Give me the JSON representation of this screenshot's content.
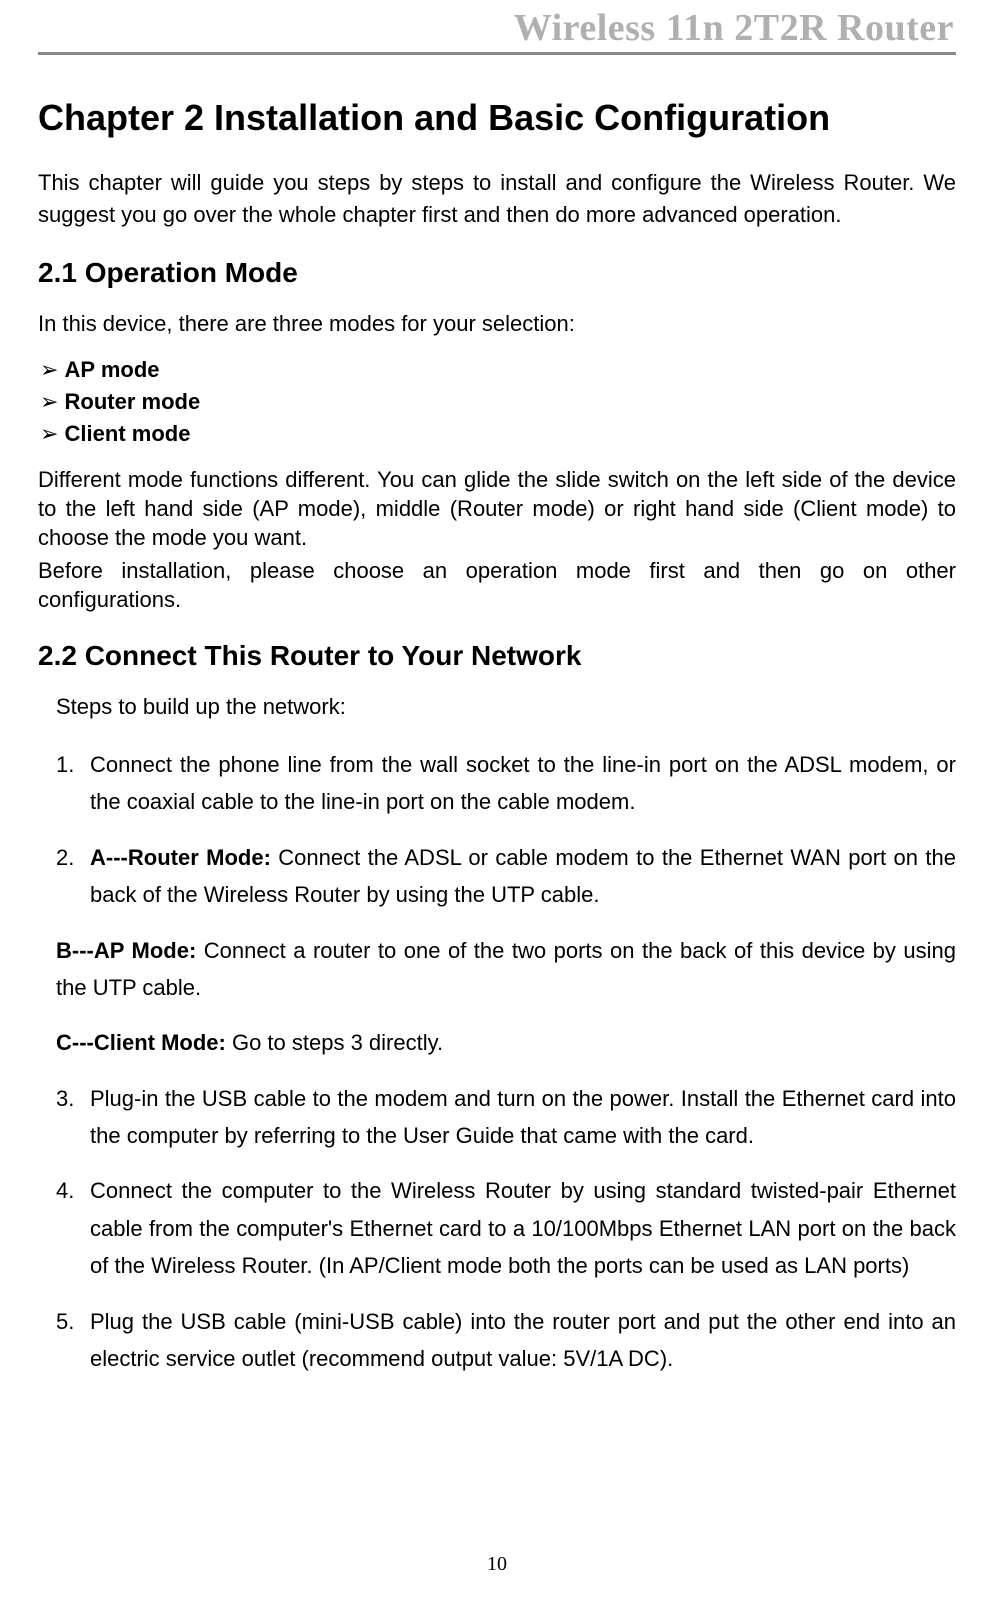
{
  "header": {
    "running_title": "Wireless 11n 2T2R Router"
  },
  "chapter": {
    "title": "Chapter 2    Installation and Basic Configuration",
    "intro": "This chapter will guide you steps by steps to install and configure the Wireless Router. We suggest you go over the whole chapter first and then do more advanced operation."
  },
  "section_2_1": {
    "heading": "2.1    Operation Mode",
    "intro": "In this device, there are three modes for your selection:",
    "modes": [
      "AP mode",
      "Router mode",
      "Client mode"
    ],
    "para1": "Different mode functions different. You can glide the slide switch on the left side of the device to the left hand side (AP mode), middle (Router mode) or right hand side (Client mode) to choose the mode you want.",
    "para2": "Before installation, please choose an operation mode first and then go on other configurations."
  },
  "section_2_2": {
    "heading": "2.2    Connect This Router to Your Network",
    "steps_intro": "Steps to build up the network:",
    "step1": {
      "num": "1.",
      "text": "Connect the phone line from the wall socket to the line-in port on the ADSL modem, or the coaxial cable to the line-in port on the cable modem."
    },
    "step2": {
      "num": "2.",
      "label_a": "A---Router Mode:",
      "text_a": " Connect the ADSL or cable modem to the Ethernet WAN port on the back of the Wireless Router by using the UTP cable.",
      "label_b": "B---AP Mode:",
      "text_b": " Connect a router to one of the two ports on the back of this device by using the UTP cable.",
      "label_c": "C---Client Mode:",
      "text_c": " Go to steps 3 directly."
    },
    "step3": {
      "num": "3.",
      "text": "Plug-in the USB cable to the modem and turn on the power. Install the Ethernet card into the computer by referring to the User Guide that came with the card."
    },
    "step4": {
      "num": "4.",
      "text": "Connect the computer to the Wireless Router by using standard twisted-pair Ethernet cable from the computer's Ethernet card to a 10/100Mbps Ethernet LAN port on the back of the Wireless Router. (In AP/Client mode both the ports can be used as LAN ports)"
    },
    "step5": {
      "num": "5.",
      "text": "Plug the USB cable (mini-USB cable) into the router port and put the other end into an electric service outlet (recommend output value: 5V/1A DC)."
    }
  },
  "page_number": "10"
}
